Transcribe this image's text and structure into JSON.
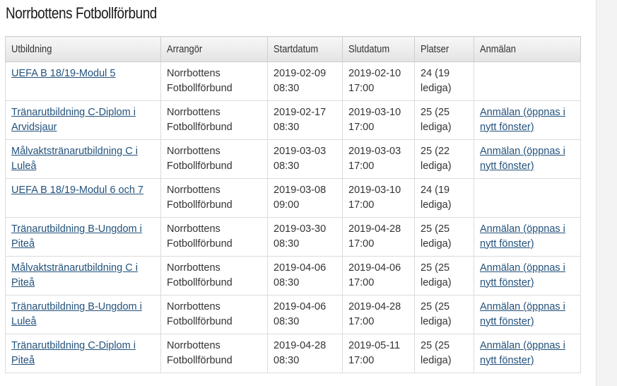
{
  "page": {
    "title": "Norrbottens Fotbollförbund"
  },
  "table": {
    "headers": [
      "Utbildning",
      "Arrangör",
      "Startdatum",
      "Slutdatum",
      "Platser",
      "Anmälan"
    ],
    "rows": [
      {
        "course": "UEFA B 18/19-Modul 5",
        "organizer": "Norrbottens Fotbollförbund",
        "start_date": "2019-02-09",
        "start_time": "08:30",
        "end_date": "2019-02-10",
        "end_time": "17:00",
        "seats": "24 (19 lediga)",
        "register": ""
      },
      {
        "course": "Tränarutbildning C-Diplom i Arvidsjaur",
        "organizer": "Norrbottens Fotbollförbund",
        "start_date": "2019-02-17",
        "start_time": "08:30",
        "end_date": "2019-03-10",
        "end_time": "17:00",
        "seats": "25 (25 lediga)",
        "register": "Anmälan (öppnas i nytt fönster)"
      },
      {
        "course": "Målvaktstränarutbildning C i Luleå",
        "organizer": "Norrbottens Fotbollförbund",
        "start_date": "2019-03-03",
        "start_time": "08:30",
        "end_date": "2019-03-03",
        "end_time": "17:00",
        "seats": "25 (22 lediga)",
        "register": "Anmälan (öppnas i nytt fönster)"
      },
      {
        "course": "UEFA B 18/19-Modul 6 och 7",
        "organizer": "Norrbottens Fotbollförbund",
        "start_date": "2019-03-08",
        "start_time": "09:00",
        "end_date": "2019-03-10",
        "end_time": "17:00",
        "seats": "24 (19 lediga)",
        "register": ""
      },
      {
        "course": "Tränarutbildning B-Ungdom i Piteå",
        "organizer": "Norrbottens Fotbollförbund",
        "start_date": "2019-03-30",
        "start_time": "08:30",
        "end_date": "2019-04-28",
        "end_time": "17:00",
        "seats": "25 (25 lediga)",
        "register": "Anmälan (öppnas i nytt fönster)"
      },
      {
        "course": "Målvaktstränarutbildning C i Piteå",
        "organizer": "Norrbottens Fotbollförbund",
        "start_date": "2019-04-06",
        "start_time": "08:30",
        "end_date": "2019-04-06",
        "end_time": "17:00",
        "seats": "25 (25 lediga)",
        "register": "Anmälan (öppnas i nytt fönster)"
      },
      {
        "course": "Tränarutbildning B-Ungdom i Luleå",
        "organizer": "Norrbottens Fotbollförbund",
        "start_date": "2019-04-06",
        "start_time": "08:30",
        "end_date": "2019-04-28",
        "end_time": "17:00",
        "seats": "25 (25 lediga)",
        "register": "Anmälan (öppnas i nytt fönster)"
      },
      {
        "course": "Tränarutbildning C-Diplom i Piteå",
        "organizer": "Norrbottens Fotbollförbund",
        "start_date": "2019-04-28",
        "start_time": "08:30",
        "end_date": "2019-05-11",
        "end_time": "17:00",
        "seats": "25 (25 lediga)",
        "register": "Anmälan (öppnas i nytt fönster)"
      }
    ]
  },
  "colors": {
    "link": "#23527c",
    "text": "#333333",
    "border": "#dcdcdc",
    "header_bg": "#e9e9e9"
  }
}
